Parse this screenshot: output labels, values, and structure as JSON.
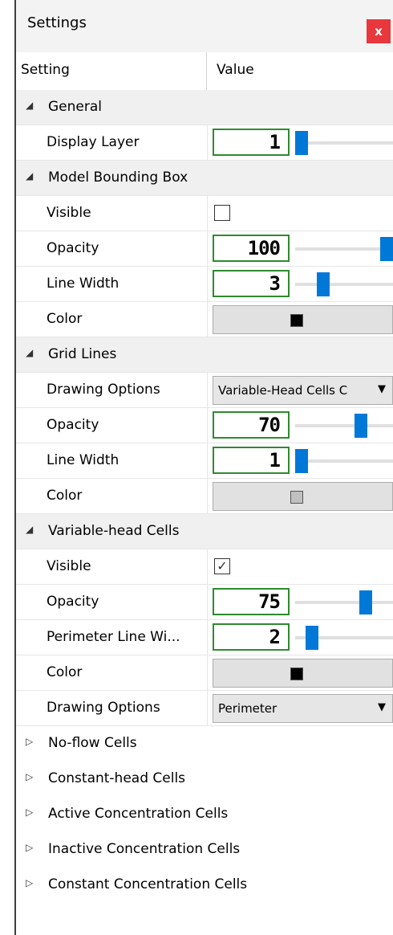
{
  "panel": {
    "title": "Settings",
    "close_label": "x"
  },
  "columns": {
    "setting": "Setting",
    "value": "Value"
  },
  "general": {
    "label": "General",
    "display_layer": {
      "label": "Display Layer",
      "value": "1",
      "fraction": 0.0
    }
  },
  "model_bbox": {
    "label": "Model Bounding Box",
    "visible": {
      "label": "Visible",
      "checked": false
    },
    "opacity": {
      "label": "Opacity",
      "value": "100",
      "fraction": 1.0
    },
    "line_width": {
      "label": "Line Width",
      "value": "3",
      "fraction": 0.25
    },
    "color": {
      "label": "Color",
      "swatch": "#000000"
    }
  },
  "grid_lines": {
    "label": "Grid Lines",
    "drawing_options": {
      "label": "Drawing Options",
      "value": "Variable-Head Cells C"
    },
    "opacity": {
      "label": "Opacity",
      "value": "70",
      "fraction": 0.7
    },
    "line_width": {
      "label": "Line Width",
      "value": "1",
      "fraction": 0.0
    },
    "color": {
      "label": "Color",
      "swatch": "#c0c0c0"
    }
  },
  "variable_head": {
    "label": "Variable-head Cells",
    "visible": {
      "label": "Visible",
      "checked": true
    },
    "opacity": {
      "label": "Opacity",
      "value": "75",
      "fraction": 0.75
    },
    "perimeter_line_width": {
      "label": "Perimeter Line Wi...",
      "value": "2",
      "fraction": 0.12
    },
    "color": {
      "label": "Color",
      "swatch": "#000000"
    },
    "drawing_options": {
      "label": "Drawing Options",
      "value": "Perimeter"
    }
  },
  "collapsed_categories": [
    "No-flow Cells",
    "Constant-head Cells",
    "Active Concentration Cells",
    "Inactive Concentration Cells",
    "Constant Concentration Cells"
  ],
  "icons": {
    "expanded": "◢",
    "collapsed": "▷",
    "checkmark": "✓",
    "dropdown": "▼"
  },
  "colors": {
    "slider_thumb": "#0078d7",
    "number_border": "#2f8a2f",
    "close_button": "#e8383d"
  }
}
